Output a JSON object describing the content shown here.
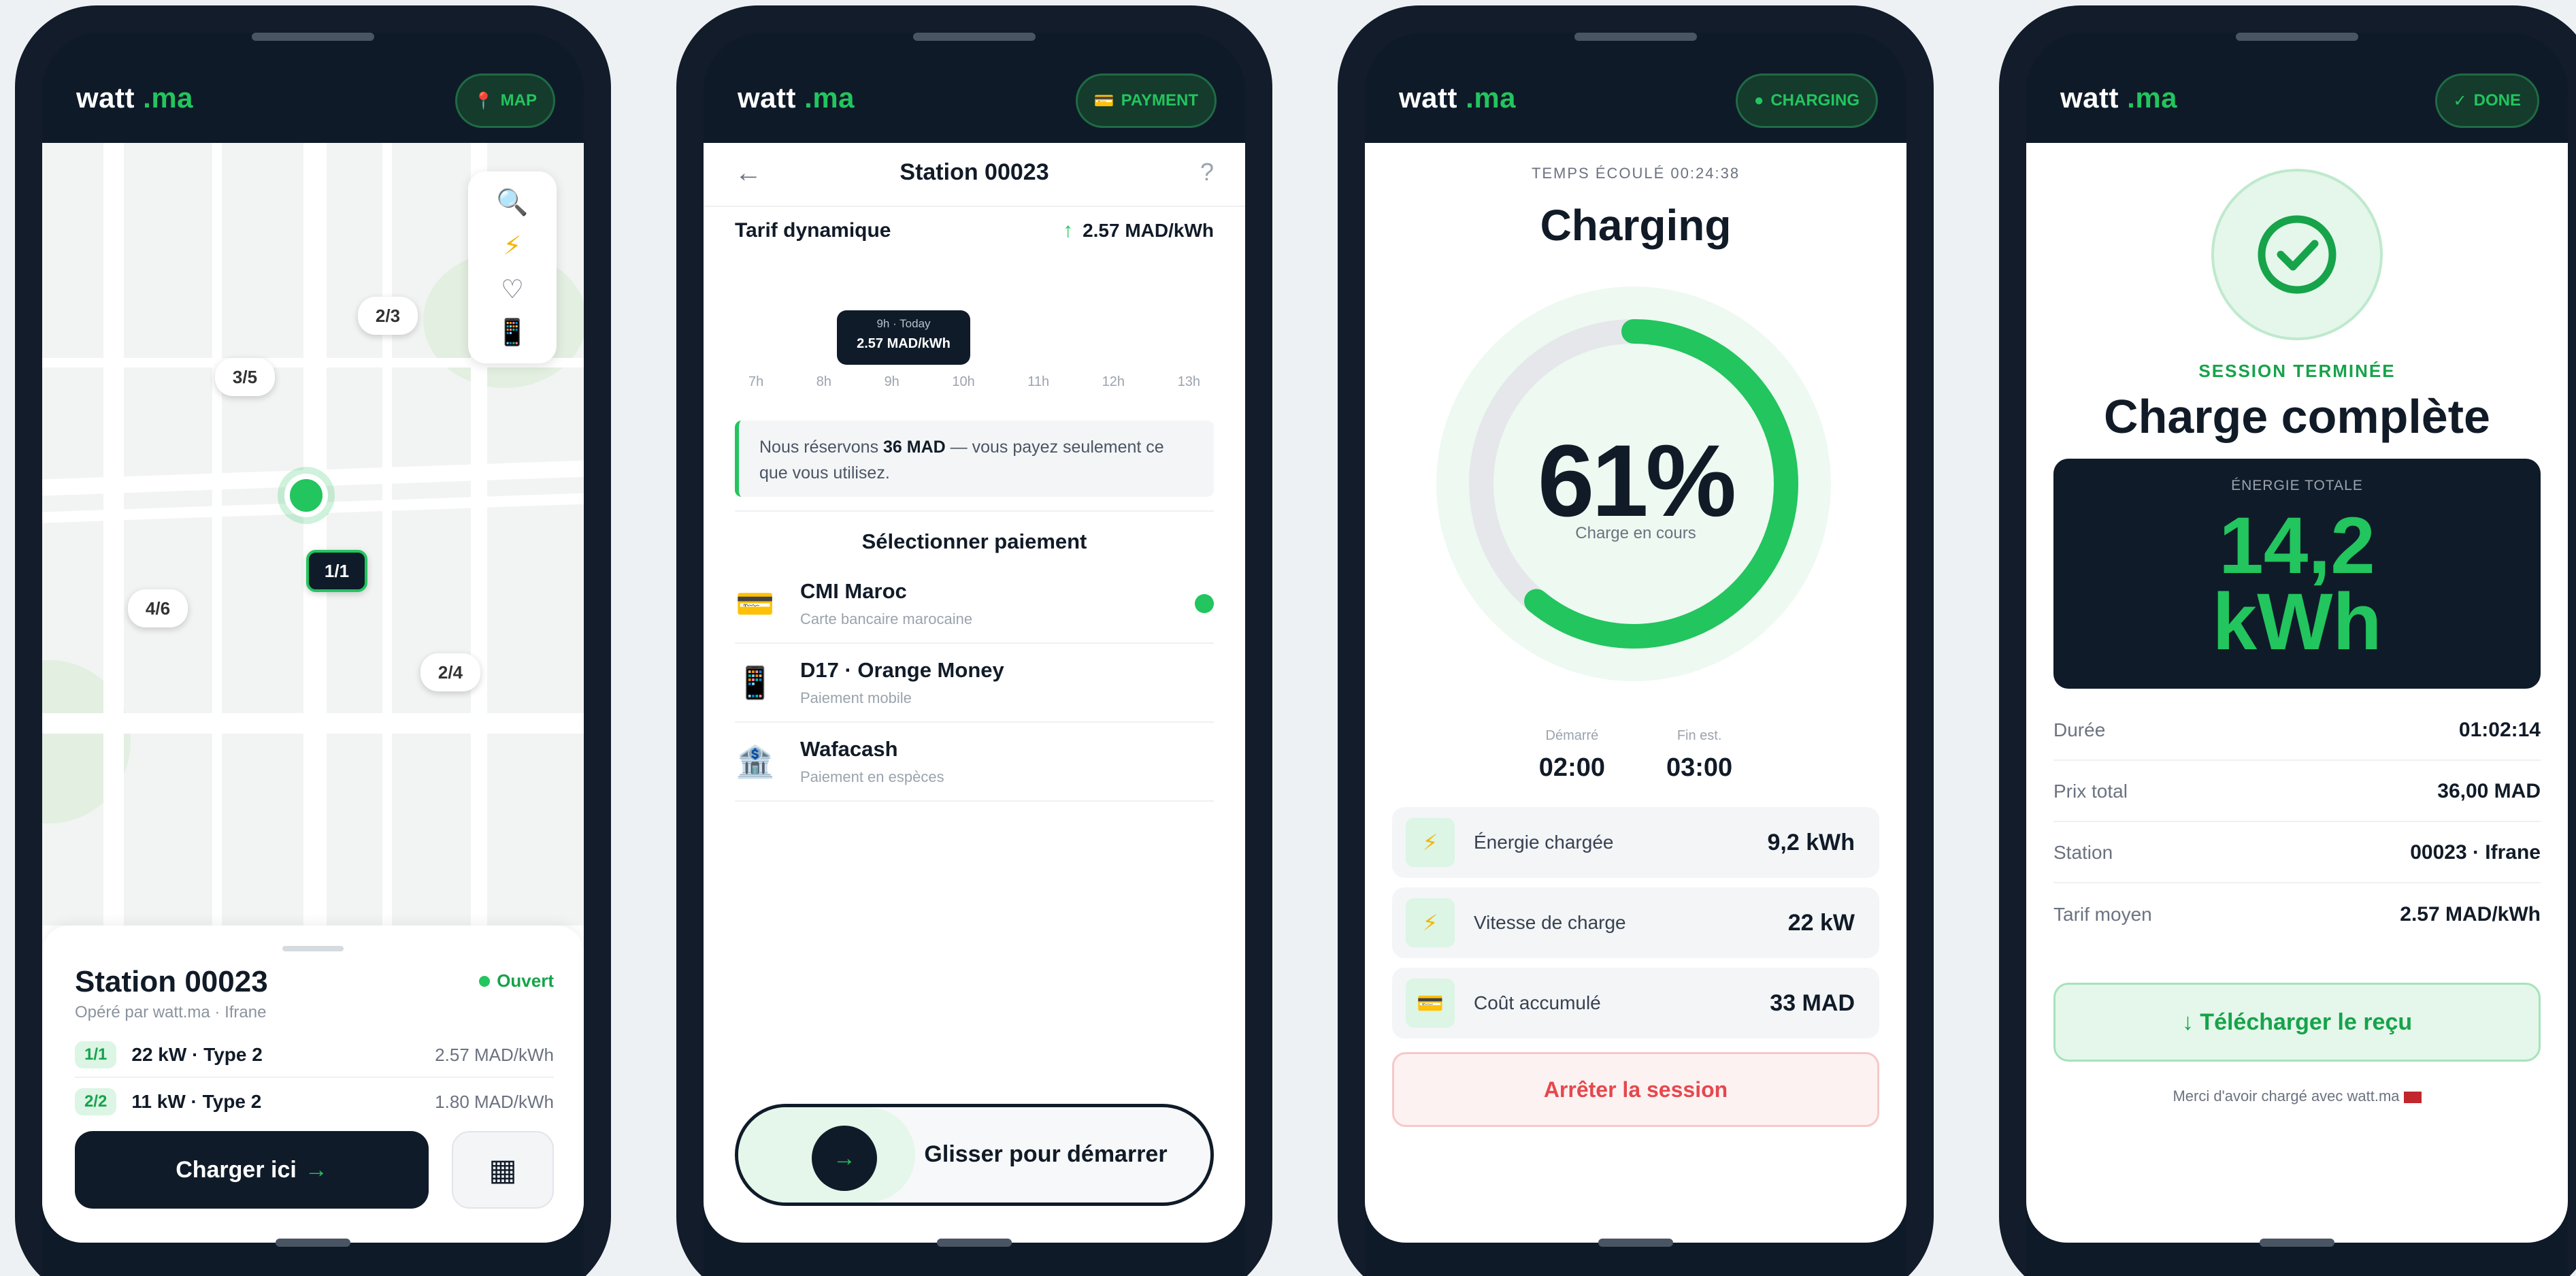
{
  "phones": [
    {
      "logo": {
        "name": "watt",
        "ext": ".ma"
      },
      "pill": {
        "icon": "📍",
        "label": "MAP"
      },
      "map": {
        "markers": [
          "2/3",
          "3/5",
          "1/1",
          "4/6",
          "2/4"
        ],
        "selected_marker": "1/1"
      },
      "station": {
        "name": "Station 00023",
        "sub": "Opéré par watt.ma · Ifrane",
        "status": "Ouvert",
        "plugs": [
          {
            "tag": "1/1",
            "spec": "22 kW · Type 2",
            "price": "2.57 MAD/kWh"
          },
          {
            "tag": "2/2",
            "spec": "11 kW · Type 2",
            "price": "1.80 MAD/kWh"
          }
        ],
        "cta": "Charger ici",
        "cta_arrow": "→"
      }
    },
    {
      "logo": {
        "name": "watt",
        "ext": ".ma"
      },
      "pill": {
        "icon": "💳",
        "label": "PAYMENT"
      },
      "topbar": {
        "back": "←",
        "title": "Station 00023",
        "help": "?"
      },
      "tarif": {
        "label": "Tarif dynamique",
        "arrow": "↑",
        "value": "2.57 MAD/kWh"
      },
      "tooltip": {
        "time": "9h · Today",
        "value": "2.57 MAD/kWh"
      },
      "hours": [
        "7h",
        "8h",
        "9h",
        "10h",
        "11h",
        "12h",
        "13h"
      ],
      "note": {
        "pre": "Nous réservons ",
        "amount": "36 MAD",
        "post": " — vous payez seulement ce que vous utilisez."
      },
      "select_title": "Sélectionner paiement",
      "methods": [
        {
          "icon": "💳",
          "name": "CMI Maroc",
          "desc": "Carte bancaire marocaine",
          "selected": true
        },
        {
          "icon": "📱",
          "name": "D17 · Orange Money",
          "desc": "Paiement mobile",
          "selected": false
        },
        {
          "icon": "🏦",
          "name": "Wafacash",
          "desc": "Paiement en espèces",
          "selected": false
        }
      ],
      "slider": {
        "arrow": "→",
        "label": "Glisser pour démarrer"
      }
    },
    {
      "logo": {
        "name": "watt",
        "ext": ".ma"
      },
      "pill": {
        "icon": "●",
        "label": "CHARGING"
      },
      "elapsed": "TEMPS ÉCOULÉ 00:24:38",
      "title": "Charging",
      "progress": 0.61,
      "percent": "61%",
      "percent_sub": "Charge en cours",
      "times": [
        {
          "label": "Démarré",
          "value": "02:00"
        },
        {
          "label": "Fin est.",
          "value": "03:00"
        }
      ],
      "stats": [
        {
          "icon": "⚡",
          "label": "Énergie chargée",
          "value": "9,2 kWh"
        },
        {
          "icon": "⚡",
          "label": "Vitesse de charge",
          "value": "22 kW"
        },
        {
          "icon": "💳",
          "label": "Coût accumulé",
          "value": "33 MAD"
        }
      ],
      "stop": "Arrêter la session"
    },
    {
      "logo": {
        "name": "watt",
        "ext": ".ma"
      },
      "pill": {
        "icon": "✓",
        "label": "DONE"
      },
      "session": "SESSION TERMINÉE",
      "title": "Charge complète",
      "energy": {
        "label": "ÉNERGIE TOTALE",
        "value1": "14,2",
        "value2": "kWh"
      },
      "rows": [
        {
          "label": "Durée",
          "value": "01:02:14"
        },
        {
          "label": "Prix total",
          "value": "36,00 MAD"
        },
        {
          "label": "Station",
          "value": "00023 · Ifrane"
        },
        {
          "label": "Tarif moyen",
          "value": "2.57 MAD/kWh"
        }
      ],
      "download": "↓ Télécharger le reçu",
      "thanks": "Merci d'avoir chargé avec watt.ma"
    }
  ],
  "colors": {
    "accent": "#22c55e",
    "dark": "#101b29",
    "danger": "#e5484d"
  }
}
